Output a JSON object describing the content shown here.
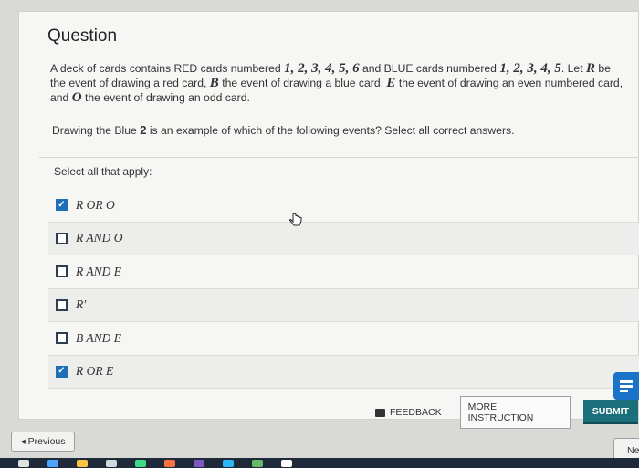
{
  "question": {
    "title": "Question",
    "text_parts": [
      "A deck of cards contains RED cards numbered ",
      "1, 2, 3, 4, 5, 6",
      " and BLUE cards numbered ",
      "1, 2, 3, 4, 5",
      ". Let ",
      "R",
      " be the event of drawing a red card, ",
      "B",
      " the event of drawing a blue card, ",
      "E",
      " the event of drawing an even numbered card, and ",
      "O",
      " the event of drawing an odd card."
    ],
    "prompt_before": "Drawing the Blue ",
    "prompt_number": "2",
    "prompt_after": " is an example of which of the following events? Select all correct answers."
  },
  "select_label": "Select all that apply:",
  "options": [
    {
      "label": "R OR O",
      "checked": true
    },
    {
      "label": "R AND O",
      "checked": false
    },
    {
      "label": "R AND E",
      "checked": false
    },
    {
      "label": "R′",
      "checked": false
    },
    {
      "label": "B AND E",
      "checked": false
    },
    {
      "label": "R OR E",
      "checked": true
    }
  ],
  "footer": {
    "feedback_label": "FEEDBACK",
    "more_instruction_label": "MORE INSTRUCTION",
    "submit_label": "SUBMIT"
  },
  "nav": {
    "previous_label": "◂ Previous",
    "next_label": "Ne"
  },
  "colors": {
    "accent": "#1f6fb8",
    "submit": "#1a6f7a",
    "side_widget": "#1a73c9"
  }
}
